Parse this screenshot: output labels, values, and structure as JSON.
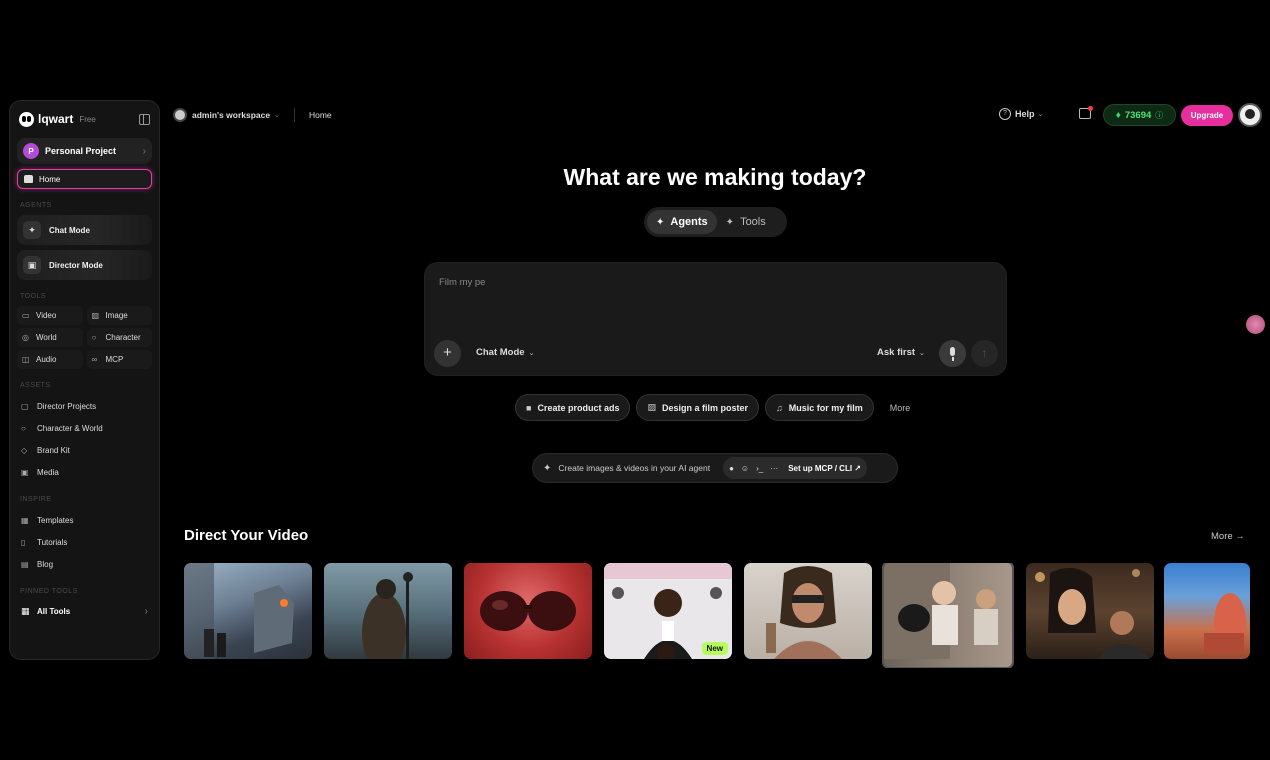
{
  "brand": {
    "name": "lqwart",
    "plan": "Free"
  },
  "project": {
    "avatar": "P",
    "name": "Personal Project"
  },
  "nav": {
    "home": "Home"
  },
  "sections": {
    "agents": "AGENTS",
    "tools": "TOOLS",
    "assets": "ASSETS",
    "inspire": "INSPIRE",
    "pinned": "PINNED TOOLS"
  },
  "agents": [
    {
      "label": "Chat Mode",
      "icon": "chat-agent-icon"
    },
    {
      "label": "Director Mode",
      "icon": "clapper-icon"
    }
  ],
  "tools": [
    {
      "label": "Video",
      "icon": "video-icon"
    },
    {
      "label": "Image",
      "icon": "image-icon"
    },
    {
      "label": "World",
      "icon": "globe-icon"
    },
    {
      "label": "Character",
      "icon": "character-icon"
    },
    {
      "label": "Audio",
      "icon": "audio-icon"
    },
    {
      "label": "MCP",
      "icon": "link-icon"
    }
  ],
  "assets": [
    {
      "label": "Director Projects"
    },
    {
      "label": "Character & World"
    },
    {
      "label": "Brand Kit"
    },
    {
      "label": "Media"
    }
  ],
  "inspire": [
    {
      "label": "Templates"
    },
    {
      "label": "Tutorials"
    },
    {
      "label": "Blog"
    }
  ],
  "pinned": {
    "label": "All Tools"
  },
  "topbar": {
    "workspace": "admin's workspace",
    "breadcrumb": "Home",
    "help": "Help",
    "credits": "73694",
    "upgrade": "Upgrade"
  },
  "hero": {
    "title": "What are we making today?"
  },
  "mode_toggle": {
    "agents": "Agents",
    "tools": "Tools"
  },
  "prompt": {
    "value": "Film my pe",
    "mode": "Chat Mode",
    "ask": "Ask first"
  },
  "suggestions": [
    "Create product ads",
    "Design a film poster",
    "Music for my film"
  ],
  "suggestions_more": "More",
  "mcp": {
    "text": "Create images & videos in your AI agent",
    "setup": "Set up MCP / CLI ↗"
  },
  "direct": {
    "title": "Direct Your Video",
    "more": "More →",
    "new_badge": "New"
  },
  "colors": {
    "accent": "#e62e9e",
    "credits": "#4ee07a",
    "new_badge": "#b6ff5a"
  }
}
